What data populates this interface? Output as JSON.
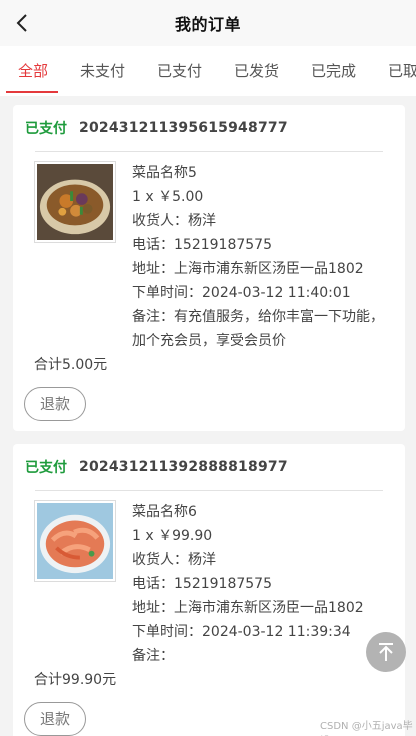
{
  "header": {
    "title": "我的订单",
    "back_icon": "chevron-left-icon"
  },
  "tabs": [
    {
      "label": "全部",
      "active": true
    },
    {
      "label": "未支付"
    },
    {
      "label": "已支付"
    },
    {
      "label": "已发货"
    },
    {
      "label": "已完成"
    },
    {
      "label": "已取"
    }
  ],
  "orders": [
    {
      "status": "已支付",
      "order_no": "20243121139561594877 7",
      "item_name": "菜品名称5",
      "qty_price": "1 x ￥5.00",
      "receiver": "收货人：杨洋",
      "phone": "电话：15219187575",
      "address": "地址：上海市浦东新区汤臣一品1802",
      "order_time": "下单时间：2024-03-12 11:40:01",
      "remark": "备注：有充值服务，给你丰富一下功能，加个充会员，享受会员价",
      "total": "合计5.00元",
      "refund_label": "退款"
    },
    {
      "status": "已支付",
      "order_no": "20243121139288881897 7",
      "item_name": "菜品名称6",
      "qty_price": "1 x ￥99.90",
      "receiver": "收货人：杨洋",
      "phone": "电话：15219187575",
      "address": "地址：上海市浦东新区汤臣一品1802",
      "order_time": "下单时间：2024-03-12 11:39:34",
      "remark": "备注：",
      "total": "合计99.90元",
      "refund_label": "退款"
    }
  ],
  "scroll_top_icon": "arrow-up-icon",
  "watermark": "CSDN @小五java毕设",
  "colors": {
    "accent": "#e4393c",
    "status": "#1e9b3c"
  }
}
